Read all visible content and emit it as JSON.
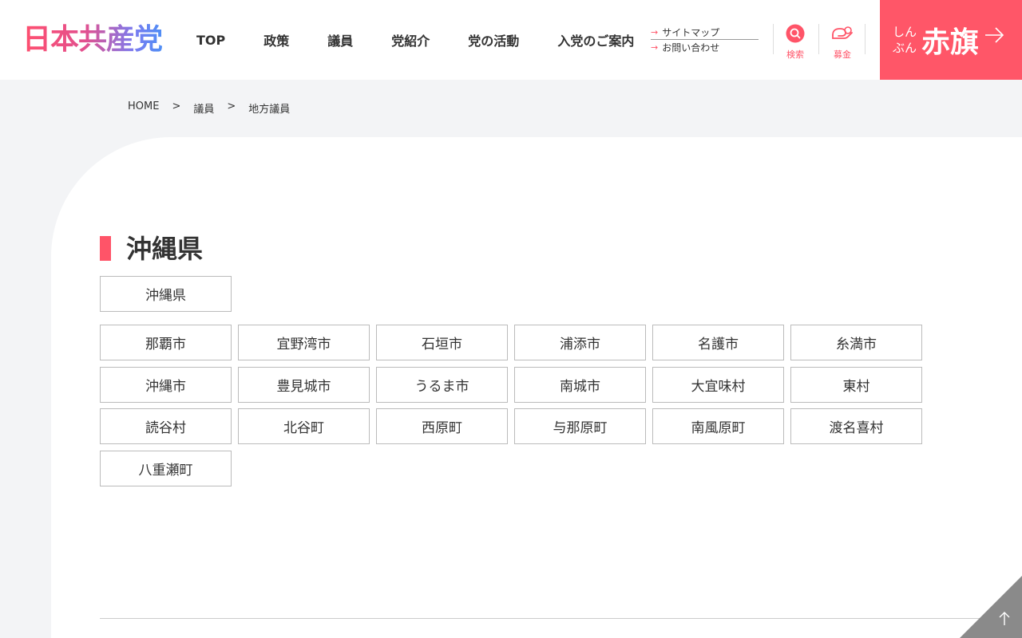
{
  "header": {
    "logo": "日本共産党",
    "nav": [
      "TOP",
      "政策",
      "議員",
      "党紹介",
      "党の活動",
      "入党のご案内"
    ],
    "sub_links": [
      "サイトマップ",
      "お問い合わせ"
    ],
    "search_label": "検索",
    "donate_label": "募金",
    "akahata_small": "しんぶん",
    "akahata_big": "赤旗"
  },
  "breadcrumb": [
    "HOME",
    "議員",
    "地方議員"
  ],
  "breadcrumb_sep": ">",
  "section": {
    "title": "沖縄県",
    "prefecture_button": "沖縄県",
    "municipalities": [
      "那覇市",
      "宜野湾市",
      "石垣市",
      "浦添市",
      "名護市",
      "糸満市",
      "沖縄市",
      "豊見城市",
      "うるま市",
      "南城市",
      "大宜味村",
      "東村",
      "読谷村",
      "北谷町",
      "西原町",
      "与那原町",
      "南風原町",
      "渡名喜村",
      "八重瀬町"
    ]
  },
  "colors": {
    "accent": "#ff5468",
    "akahata_bg": "#ff5668",
    "page_bg": "#f3f4f6"
  },
  "icons": {
    "search": "search-icon",
    "donate": "donation-icon",
    "page_top": "arrow-up-icon"
  }
}
